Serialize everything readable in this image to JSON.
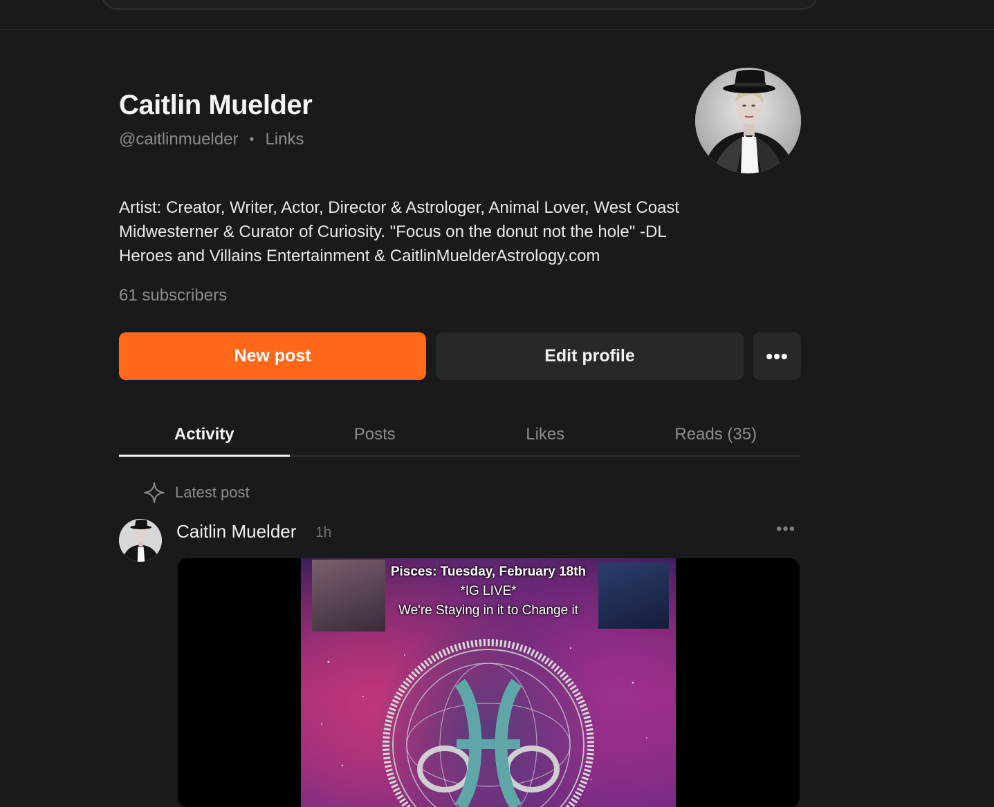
{
  "profile": {
    "name": "Caitlin Muelder",
    "handle": "@caitlinmuelder",
    "separator": "•",
    "links_label": "Links",
    "bio_lines": [
      "Artist: Creator, Writer, Actor, Director & Astrologer, Animal Lover, West Coast",
      "Midwesterner & Curator of Curiosity. \"Focus on the donut not the hole\" -DL",
      "Heroes and Villains Entertainment & CaitlinMuelderAstrology.com"
    ],
    "subscribers": "61 subscribers"
  },
  "actions": {
    "new_post": "New post",
    "edit_profile": "Edit profile",
    "more": "•••"
  },
  "tabs": [
    {
      "label": "Activity",
      "active": true
    },
    {
      "label": "Posts",
      "active": false
    },
    {
      "label": "Likes",
      "active": false
    },
    {
      "label": "Reads (35)",
      "active": false
    }
  ],
  "feed": {
    "section_label": "Latest post",
    "section_icon": "sparkle-icon",
    "post": {
      "author": "Caitlin Muelder",
      "time": "1h",
      "more": "•••",
      "image_text": {
        "line1": "Pisces: Tuesday, February 18th",
        "line2": "*IG LIVE*",
        "line3": "We're Staying in it to Change it"
      }
    }
  },
  "colors": {
    "background": "#181a1c",
    "accent": "#ff6719",
    "button_secondary": "#26282b",
    "muted_text": "#8a8c8f"
  }
}
